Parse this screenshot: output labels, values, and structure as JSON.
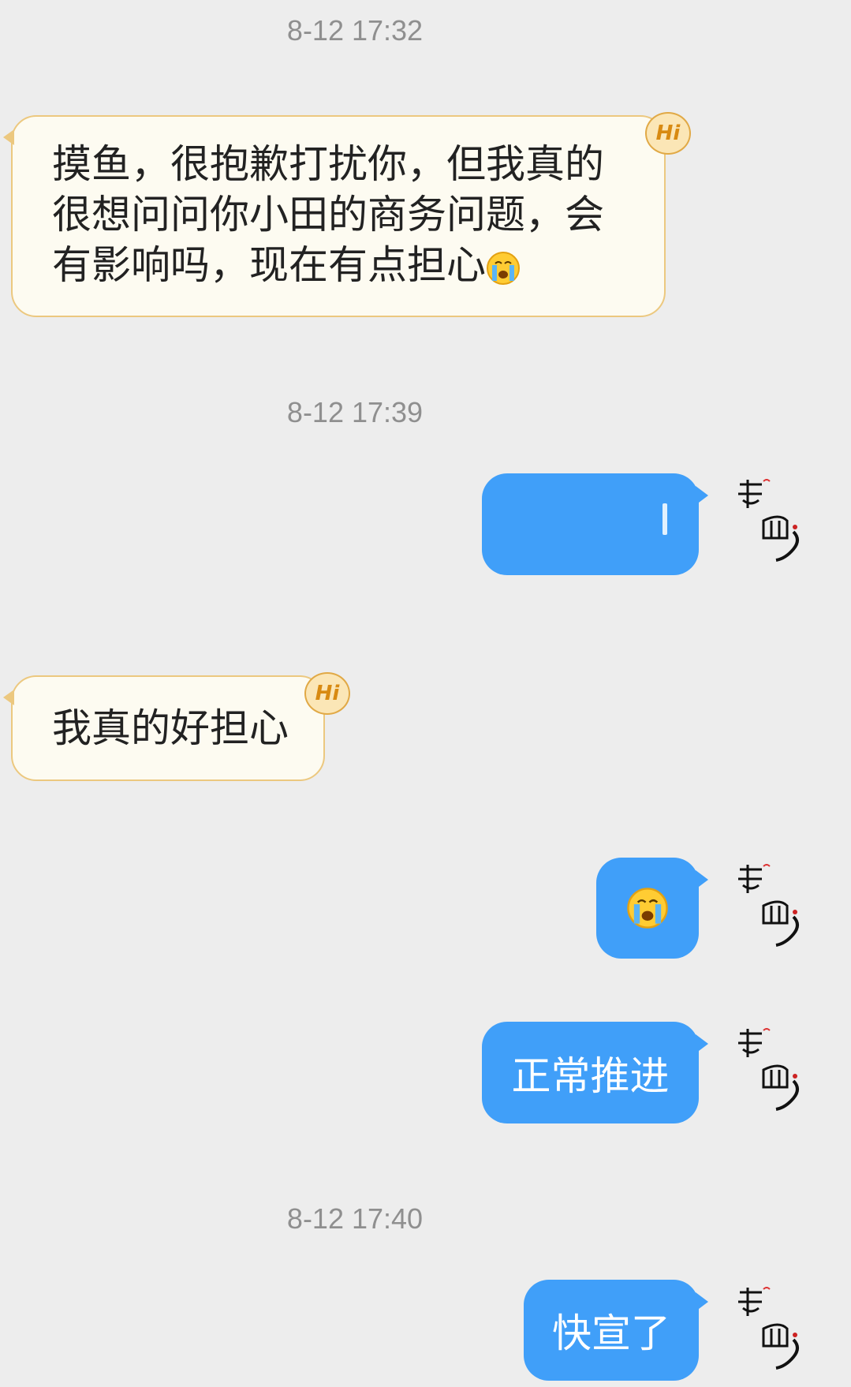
{
  "timestamps": [
    "8-12 17:32",
    "8-12 17:39",
    "8-12 17:40"
  ],
  "messages": {
    "m1": {
      "text": "摸鱼，很抱歉打扰你，但我真的很想问问你小田的商务问题，会有影响吗，现在有点担心",
      "emoji": "loudly-crying-face"
    },
    "m2": {
      "text": ""
    },
    "m3": {
      "text": "我真的好担心"
    },
    "m4": {
      "emoji": "loudly-crying-face"
    },
    "m5": {
      "text": "正常推进"
    },
    "m6": {
      "text": "快宣了"
    }
  },
  "badge": {
    "text": "Hi"
  },
  "colors": {
    "background": "#ededed",
    "incoming_bubble": "#fdfbf1",
    "incoming_border": "#ecc87f",
    "outgoing_bubble": "#409ff9",
    "timestamp": "#8f8f8f"
  }
}
